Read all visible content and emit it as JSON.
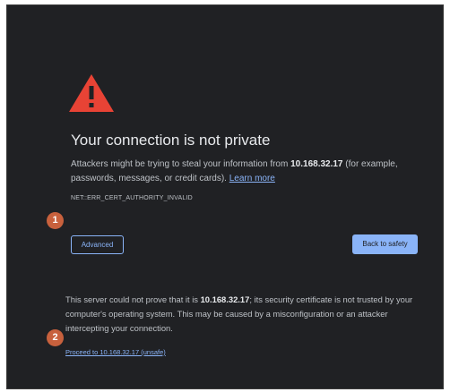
{
  "page": {
    "title": "Your connection is not private",
    "description_prefix": "Attackers might be trying to steal your information from ",
    "host": "10.168.32.17",
    "description_suffix": " (for example, passwords, messages, or credit cards). ",
    "learn_more_label": "Learn more",
    "error_code": "NET::ERR_CERT_AUTHORITY_INVALID",
    "advanced_label": "Advanced",
    "back_label": "Back to safety",
    "details_prefix": "This server could not prove that it is ",
    "details_host": "10.168.32.17",
    "details_suffix": "; its security certificate is not trusted by your computer's operating system. This may be caused by a misconfiguration or an attacker intercepting your connection.",
    "proceed_label": "Proceed to 10.168.32.17 (unsafe)"
  },
  "annotations": {
    "marker_1": "1",
    "marker_2": "2"
  },
  "icons": {
    "warning": "warning-triangle-icon"
  },
  "colors": {
    "background": "#202124",
    "warning": "#e84335",
    "accent": "#8ab4f8",
    "marker": "#c8613d"
  }
}
